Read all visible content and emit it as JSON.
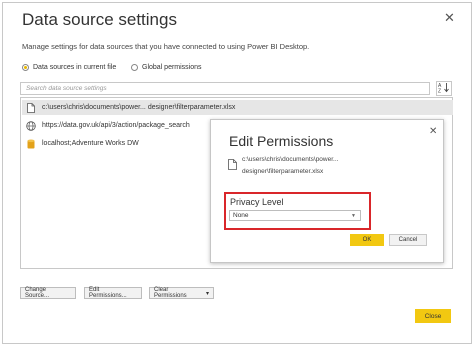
{
  "dialog": {
    "title": "Data source settings",
    "close_glyph": "✕",
    "description": "Manage settings for data sources that you have connected to using Power BI Desktop."
  },
  "scope": {
    "current_file_label": "Data sources in current file",
    "global_label": "Global permissions",
    "selected": "current_file"
  },
  "search": {
    "placeholder": "Search data source settings",
    "sort_icon": "sort-az-icon"
  },
  "sources": [
    {
      "label": "c:\\users\\chris\\documents\\power... designer\\filterparameter.xlsx",
      "icon": "file-icon",
      "selected": true
    },
    {
      "label": "https://data.gov.uk/api/3/action/package_search",
      "icon": "globe-icon",
      "selected": false
    },
    {
      "label": "localhost;Adventure Works DW",
      "icon": "database-icon",
      "selected": false
    }
  ],
  "buttons": {
    "change_source": "Change Source...",
    "edit_permissions": "Edit Permissions...",
    "clear_permissions": "Clear Permissions",
    "clear_caret": "▾",
    "close": "Close"
  },
  "edit_permissions": {
    "title": "Edit Permissions",
    "close_glyph": "✕",
    "path_line1": "c:\\users\\chris\\documents\\power...",
    "path_line2": "designer\\filterparameter.xlsx",
    "privacy_label": "Privacy Level",
    "privacy_value": "None",
    "ok": "OK",
    "cancel": "Cancel"
  },
  "colors": {
    "accent_yellow": "#f2c811",
    "highlight_red": "#d9262a",
    "selected_row": "#e6e6e6"
  }
}
